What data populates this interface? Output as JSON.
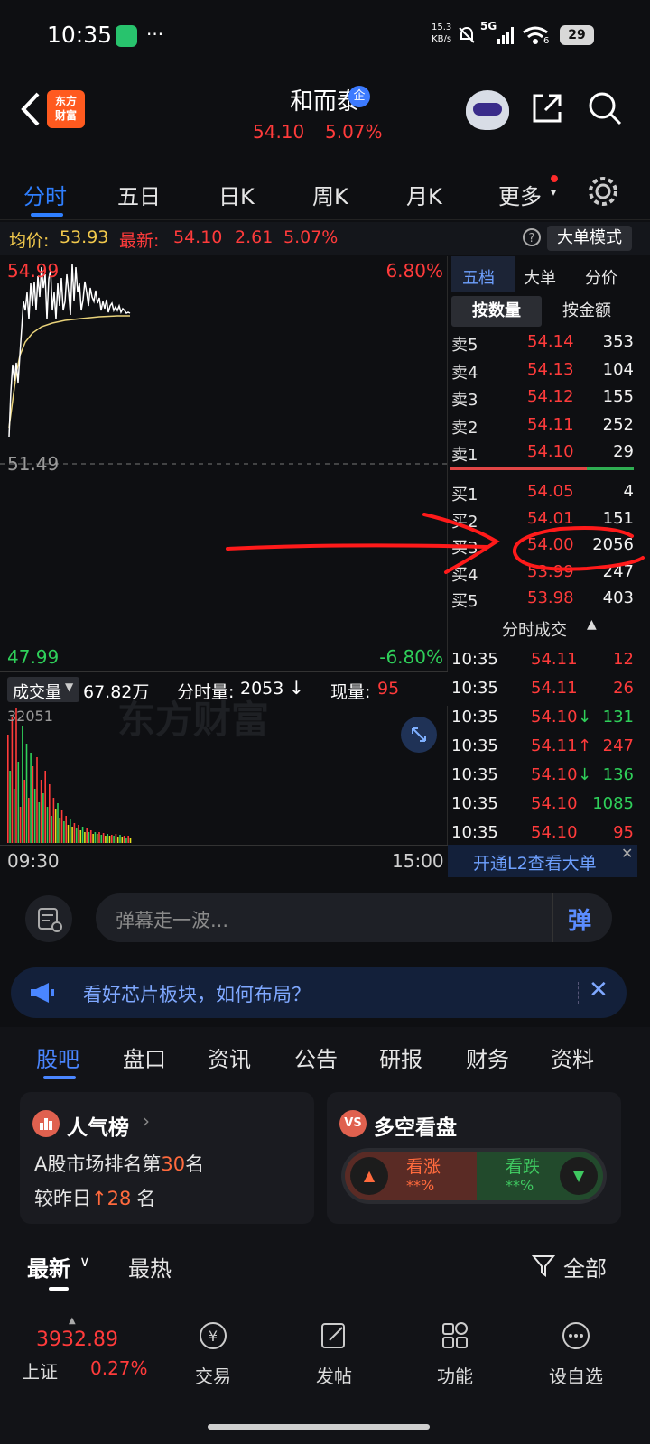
{
  "status": {
    "time": "10:35",
    "dots": "···",
    "net_speed_top": "15.3",
    "net_speed_bottom": "KB/s",
    "signal": "5G",
    "wifi_badge": "6",
    "battery": "29"
  },
  "header": {
    "logo_line1": "东方",
    "logo_line2": "财富",
    "stock_name": "和而泰",
    "badge": "企",
    "price": "54.10",
    "change_pct": "5.07%"
  },
  "tabs": [
    "分时",
    "五日",
    "日K",
    "周K",
    "月K",
    "更多"
  ],
  "info": {
    "avg_label": "均价:",
    "avg_value": "53.93",
    "latest_label": "最新:",
    "latest_value": "54.10",
    "change": "2.61",
    "change_pct": "5.07%",
    "big_order_btn": "大单模式"
  },
  "chart": {
    "high": "54.99",
    "high_pct": "6.80%",
    "mid": "51.49",
    "low": "47.99",
    "low_pct": "-6.80%",
    "watermark": "东方财富",
    "start_time": "09:30",
    "end_time": "15:00"
  },
  "volume": {
    "label": "成交量",
    "total": "67.82万",
    "minute_label": "分时量:",
    "minute_value": "2053",
    "now_label": "现量:",
    "now_value": "95",
    "max": "32051"
  },
  "order_book": {
    "tabs": [
      "五档",
      "大单",
      "分价"
    ],
    "mode_tabs": [
      "按数量",
      "按金额"
    ],
    "asks": [
      {
        "label": "卖5",
        "price": "54.14",
        "vol": "353"
      },
      {
        "label": "卖4",
        "price": "54.13",
        "vol": "104"
      },
      {
        "label": "卖3",
        "price": "54.12",
        "vol": "155"
      },
      {
        "label": "卖2",
        "price": "54.11",
        "vol": "252"
      },
      {
        "label": "卖1",
        "price": "54.10",
        "vol": "29"
      }
    ],
    "bids": [
      {
        "label": "买1",
        "price": "54.05",
        "vol": "4"
      },
      {
        "label": "买2",
        "price": "54.01",
        "vol": "151"
      },
      {
        "label": "买3",
        "price": "54.00",
        "vol": "2056"
      },
      {
        "label": "买4",
        "price": "53.99",
        "vol": "247"
      },
      {
        "label": "买5",
        "price": "53.98",
        "vol": "403"
      }
    ],
    "ticks_title": "分时成交",
    "ticks": [
      {
        "time": "10:35",
        "price": "54.11",
        "arrow": "",
        "vol": "12",
        "vol_color": "red"
      },
      {
        "time": "10:35",
        "price": "54.11",
        "arrow": "",
        "vol": "26",
        "vol_color": "red"
      },
      {
        "time": "10:35",
        "price": "54.10",
        "arrow": "↓",
        "vol": "131",
        "vol_color": "green"
      },
      {
        "time": "10:35",
        "price": "54.11",
        "arrow": "↑",
        "vol": "247",
        "vol_color": "red"
      },
      {
        "time": "10:35",
        "price": "54.10",
        "arrow": "↓",
        "vol": "136",
        "vol_color": "green"
      },
      {
        "time": "10:35",
        "price": "54.10",
        "arrow": "",
        "vol": "1085",
        "vol_color": "green"
      },
      {
        "time": "10:35",
        "price": "54.10",
        "arrow": "",
        "vol": "95",
        "vol_color": "red"
      }
    ],
    "l2_link": "开通L2查看大单"
  },
  "danmaku": {
    "placeholder": "弹幕走一波...",
    "send": "弹"
  },
  "banner": {
    "text": "看好芯片板块，如何布局？"
  },
  "lower_tabs": [
    "股吧",
    "盘口",
    "资讯",
    "公告",
    "研报",
    "财务",
    "资料"
  ],
  "popularity": {
    "title": "人气榜",
    "rank_prefix": "A股市场排名第",
    "rank": "30",
    "rank_suffix": "名",
    "prev_prefix": "较昨日",
    "prev_change": "28",
    "prev_suffix": "名"
  },
  "bullbear": {
    "title": "多空看盘",
    "bull_label": "看涨",
    "bull_value": "**%",
    "bear_label": "看跌",
    "bear_value": "**%"
  },
  "feed": {
    "newest": "最新",
    "hottest": "最热",
    "filter": "全部"
  },
  "bottom_nav": {
    "index_value": "3932.89",
    "index_name": "上证",
    "index_pct": "0.27%",
    "items": [
      "交易",
      "发帖",
      "功能",
      "设自选"
    ]
  }
}
